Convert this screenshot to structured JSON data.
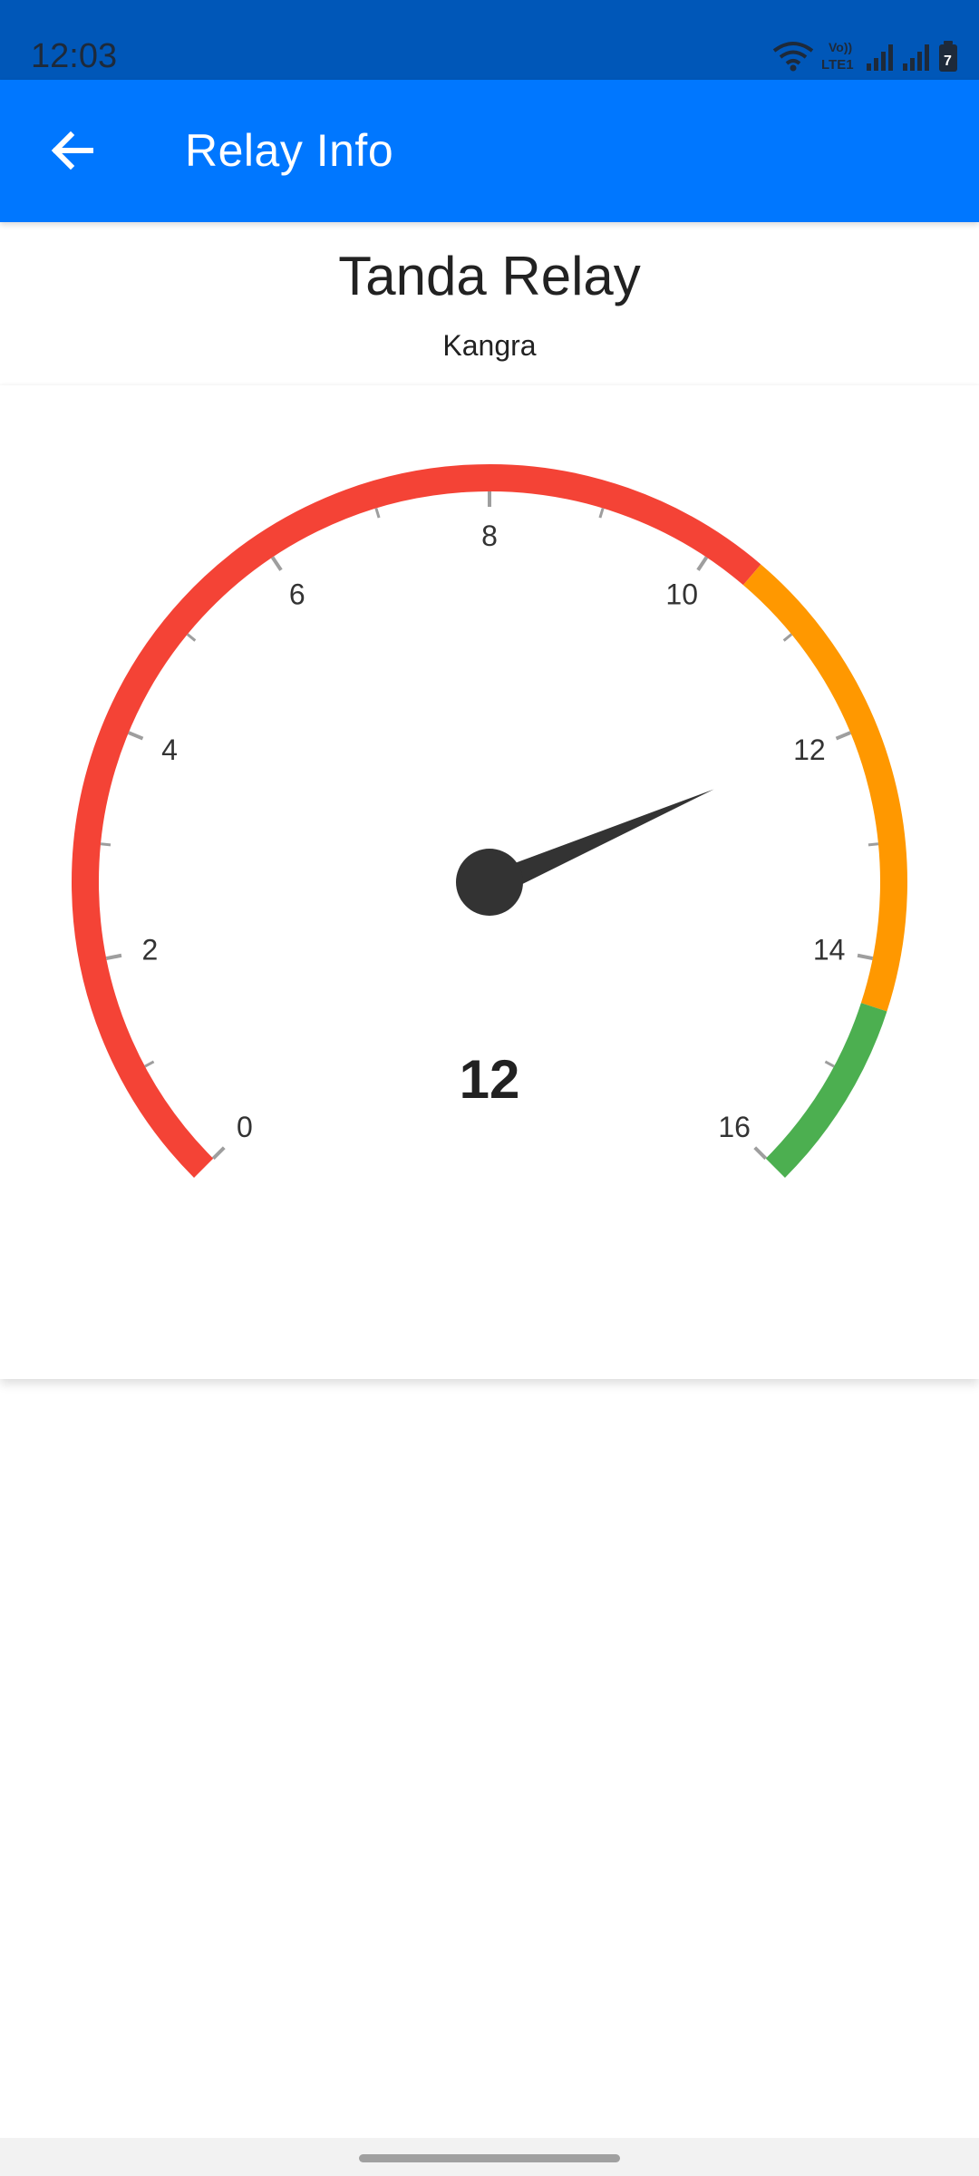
{
  "status_bar": {
    "time": "12:03",
    "volte_label": "Vo))",
    "lte_label": "LTE1",
    "battery_label": "7"
  },
  "app_bar": {
    "title": "Relay Info",
    "back_icon": "arrow-left-icon"
  },
  "relay": {
    "name": "Tanda Relay",
    "district": "Kangra"
  },
  "gauge": {
    "value": 12,
    "value_label": "12",
    "min": 0,
    "max": 16,
    "major_labels": [
      "0",
      "2",
      "4",
      "6",
      "8",
      "10",
      "12",
      "14",
      "16"
    ],
    "bands": [
      {
        "from": 0,
        "to": 10.4,
        "color": "#f44336"
      },
      {
        "from": 10.4,
        "to": 14.4,
        "color": "#ff9800"
      },
      {
        "from": 14.4,
        "to": 16,
        "color": "#4caf50"
      }
    ],
    "needle_color": "#333333",
    "tick_color": "#9e9e9e"
  }
}
